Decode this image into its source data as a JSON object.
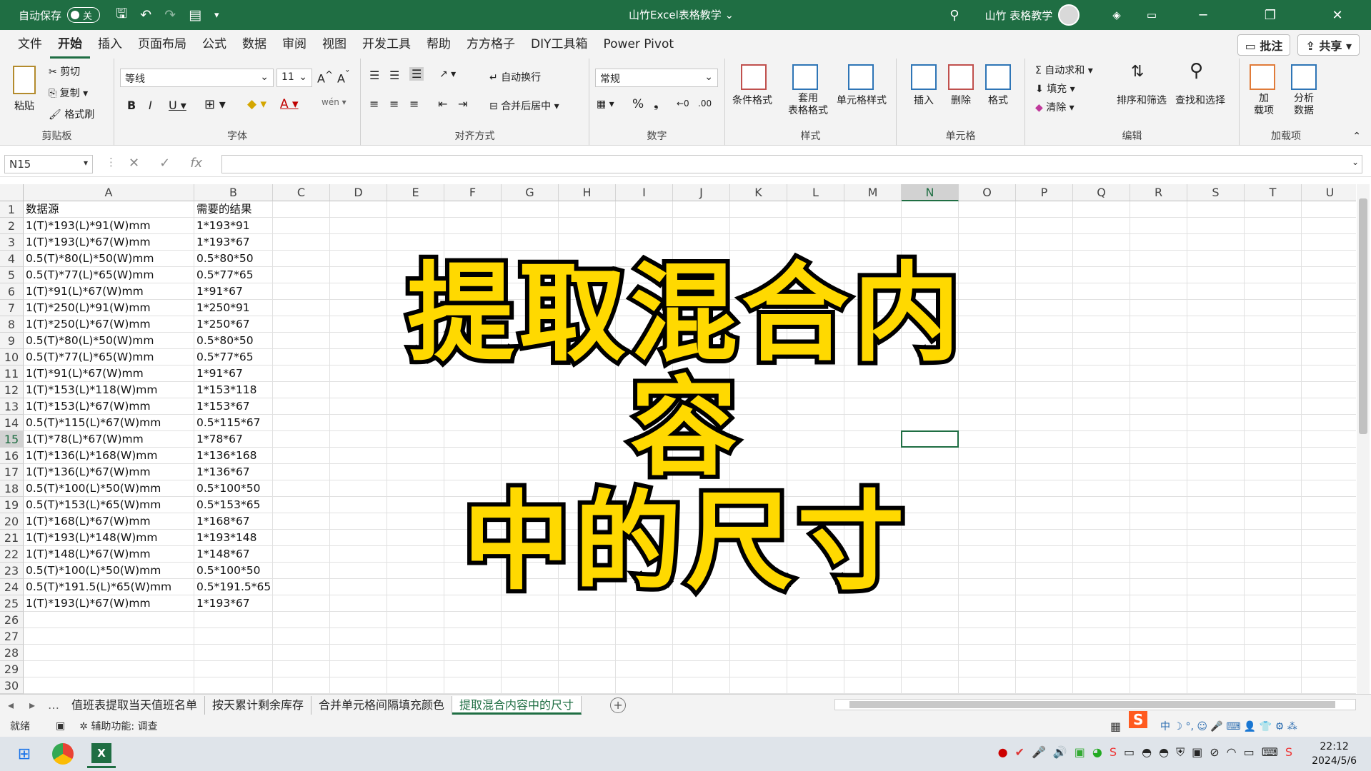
{
  "titlebar": {
    "autosave_label": "自动保存",
    "autosave_state": "关",
    "title": "山竹Excel表格教学",
    "user": "山竹 表格教学"
  },
  "menu": {
    "tabs": [
      "文件",
      "开始",
      "插入",
      "页面布局",
      "公式",
      "数据",
      "审阅",
      "视图",
      "开发工具",
      "帮助",
      "方方格子",
      "DIY工具箱",
      "Power Pivot"
    ],
    "comment_btn": "批注",
    "share_btn": "共享"
  },
  "ribbon": {
    "clipboard": {
      "paste": "粘贴",
      "cut": "剪切",
      "copy": "复制",
      "format_painter": "格式刷",
      "label": "剪贴板"
    },
    "font": {
      "name": "等线",
      "size": "11",
      "label": "字体"
    },
    "align": {
      "wrap": "自动换行",
      "merge": "合并后居中",
      "label": "对齐方式"
    },
    "number": {
      "format": "常规",
      "label": "数字"
    },
    "styles": {
      "cond": "条件格式",
      "table": "套用\n表格格式",
      "cell": "单元格样式",
      "label": "样式"
    },
    "cells": {
      "insert": "插入",
      "delete": "删除",
      "format": "格式",
      "label": "单元格"
    },
    "edit": {
      "autosum": "自动求和",
      "fill": "填充",
      "clear": "清除",
      "sort": "排序和筛选",
      "find": "查找和选择",
      "label": "编辑"
    },
    "addins": {
      "addin": "加\n载项",
      "analyze": "分析\n数据",
      "label": "加载项"
    }
  },
  "formula": {
    "namebox": "N15",
    "fx": "fx"
  },
  "columns": [
    "A",
    "B",
    "C",
    "D",
    "E",
    "F",
    "G",
    "H",
    "I",
    "J",
    "K",
    "L",
    "M",
    "N",
    "O",
    "P",
    "Q",
    "R",
    "S",
    "T",
    "U"
  ],
  "rows": [
    "1",
    "2",
    "3",
    "4",
    "5",
    "6",
    "7",
    "8",
    "9",
    "10",
    "11",
    "12",
    "13",
    "14",
    "15",
    "16",
    "17",
    "18",
    "19",
    "20",
    "21",
    "22",
    "23",
    "24",
    "25",
    "26",
    "27",
    "28",
    "29",
    "30"
  ],
  "cells": {
    "a": [
      "数据源",
      "1(T)*193(L)*91(W)mm",
      "1(T)*193(L)*67(W)mm",
      "0.5(T)*80(L)*50(W)mm",
      "0.5(T)*77(L)*65(W)mm",
      "1(T)*91(L)*67(W)mm",
      "1(T)*250(L)*91(W)mm",
      "1(T)*250(L)*67(W)mm",
      "0.5(T)*80(L)*50(W)mm",
      "0.5(T)*77(L)*65(W)mm",
      "1(T)*91(L)*67(W)mm",
      "1(T)*153(L)*118(W)mm",
      "1(T)*153(L)*67(W)mm",
      "0.5(T)*115(L)*67(W)mm",
      "1(T)*78(L)*67(W)mm",
      "1(T)*136(L)*168(W)mm",
      "1(T)*136(L)*67(W)mm",
      "0.5(T)*100(L)*50(W)mm",
      "0.5(T)*153(L)*65(W)mm",
      "1(T)*168(L)*67(W)mm",
      "1(T)*193(L)*148(W)mm",
      "1(T)*148(L)*67(W)mm",
      "0.5(T)*100(L)*50(W)mm",
      "0.5(T)*191.5(L)*65(W)mm",
      "1(T)*193(L)*67(W)mm"
    ],
    "b": [
      "需要的结果",
      "1*193*91",
      "1*193*67",
      "0.5*80*50",
      "0.5*77*65",
      "1*91*67",
      "1*250*91",
      "1*250*67",
      "0.5*80*50",
      "0.5*77*65",
      "1*91*67",
      "1*153*118",
      "1*153*67",
      "0.5*115*67",
      "1*78*67",
      "1*136*168",
      "1*136*67",
      "0.5*100*50",
      "0.5*153*65",
      "1*168*67",
      "1*193*148",
      "1*148*67",
      "0.5*100*50",
      "0.5*191.5*65",
      "1*193*67"
    ]
  },
  "overlay": {
    "line1": "提取混合内容",
    "line2": "中的尺寸"
  },
  "sheets": [
    "值班表提取当天值班名单",
    "按天累计剩余库存",
    "合并单元格间隔填充颜色",
    "提取混合内容中的尺寸"
  ],
  "status": {
    "ready": "就绪",
    "accessibility": "辅助功能: 调查"
  },
  "clock": {
    "time": "22:12",
    "date": "2024/5/6"
  }
}
